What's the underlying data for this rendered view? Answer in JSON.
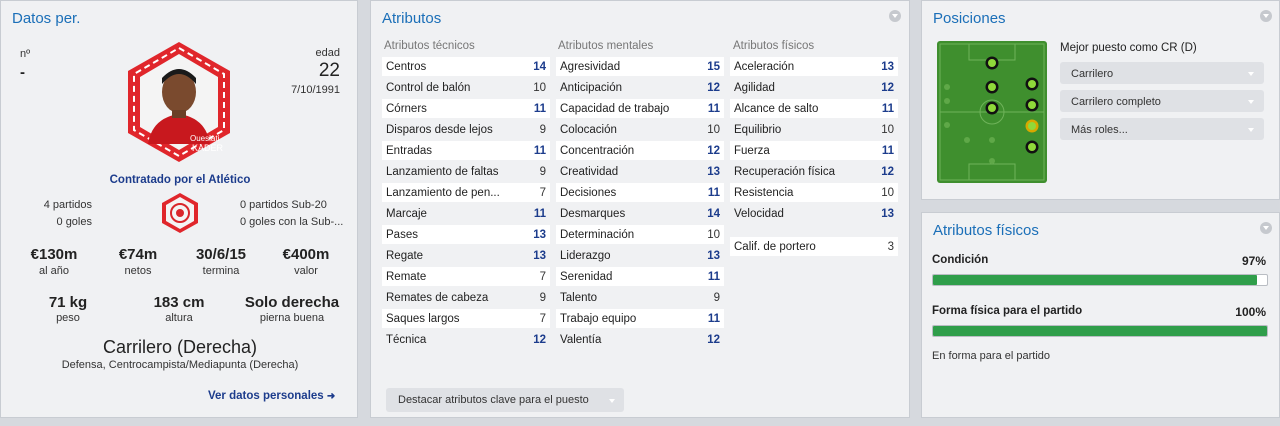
{
  "personal": {
    "title": "Datos per.",
    "number_label": "nº",
    "number_value": "-",
    "age_label": "edad",
    "age_value": "22",
    "birthdate": "7/10/1991",
    "photo_caption_1": "Oueslati",
    "photo_caption_2": "KADER",
    "contract": "Contratado por el Atlético",
    "apps": "4 partidos",
    "goals": "0 goles",
    "u20_apps": "0 partidos Sub-20",
    "u20_goals": "0 goles con la Sub-...",
    "stats": [
      {
        "value": "€130m",
        "label": "al año"
      },
      {
        "value": "€74m",
        "label": "netos"
      },
      {
        "value": "30/6/15",
        "label": "termina"
      },
      {
        "value": "€400m",
        "label": "valor"
      }
    ],
    "body": [
      {
        "value": "71 kg",
        "label": "peso"
      },
      {
        "value": "183 cm",
        "label": "altura"
      },
      {
        "value": "Solo derecha",
        "label": "pierna buena"
      }
    ],
    "position": "Carrilero (Derecha)",
    "positions_sub": "Defensa, Centrocampista/Mediapunta (Derecha)",
    "link": "Ver datos personales"
  },
  "attributes": {
    "title": "Atributos",
    "tech_header": "Atributos técnicos",
    "mental_header": "Atributos mentales",
    "phys_header": "Atributos físicos",
    "technical": [
      [
        "Centros",
        "14"
      ],
      [
        "Control de balón",
        "10"
      ],
      [
        "Córners",
        "11"
      ],
      [
        "Disparos desde lejos",
        "9"
      ],
      [
        "Entradas",
        "11"
      ],
      [
        "Lanzamiento de faltas",
        "9"
      ],
      [
        "Lanzamiento de pen...",
        "7"
      ],
      [
        "Marcaje",
        "11"
      ],
      [
        "Pases",
        "13"
      ],
      [
        "Regate",
        "13"
      ],
      [
        "Remate",
        "7"
      ],
      [
        "Remates de cabeza",
        "9"
      ],
      [
        "Saques largos",
        "7"
      ],
      [
        "Técnica",
        "12"
      ]
    ],
    "mental": [
      [
        "Agresividad",
        "15"
      ],
      [
        "Anticipación",
        "12"
      ],
      [
        "Capacidad de trabajo",
        "11"
      ],
      [
        "Colocación",
        "10"
      ],
      [
        "Concentración",
        "12"
      ],
      [
        "Creatividad",
        "13"
      ],
      [
        "Decisiones",
        "11"
      ],
      [
        "Desmarques",
        "14"
      ],
      [
        "Determinación",
        "10"
      ],
      [
        "Liderazgo",
        "13"
      ],
      [
        "Serenidad",
        "11"
      ],
      [
        "Talento",
        "9"
      ],
      [
        "Trabajo equipo",
        "11"
      ],
      [
        "Valentía",
        "12"
      ]
    ],
    "physical": [
      [
        "Aceleración",
        "13"
      ],
      [
        "Agilidad",
        "12"
      ],
      [
        "Alcance de salto",
        "11"
      ],
      [
        "Equilibrio",
        "10"
      ],
      [
        "Fuerza",
        "11"
      ],
      [
        "Recuperación física",
        "12"
      ],
      [
        "Resistencia",
        "10"
      ],
      [
        "Velocidad",
        "13"
      ]
    ],
    "goalkeeper": [
      "Calif. de portero",
      "3"
    ],
    "highlight_button": "Destacar atributos clave para el puesto"
  },
  "positions": {
    "title": "Posiciones",
    "best_role": "Mejor puesto como CR (D)",
    "roles": [
      "Carrilero",
      "Carrilero completo",
      "Más roles..."
    ]
  },
  "physical_panel": {
    "title": "Atributos físicos",
    "condition_label": "Condición",
    "condition_value": "97%",
    "condition_level": 0.97,
    "fitness_label": "Forma física para el partido",
    "fitness_value": "100%",
    "fitness_level": 1.0,
    "fitness_status": "En forma para el partido"
  },
  "colors": {
    "accent": "#1b6fb8",
    "bar_fill": "#2f9e4a",
    "pitch": "#3f8f2e"
  }
}
